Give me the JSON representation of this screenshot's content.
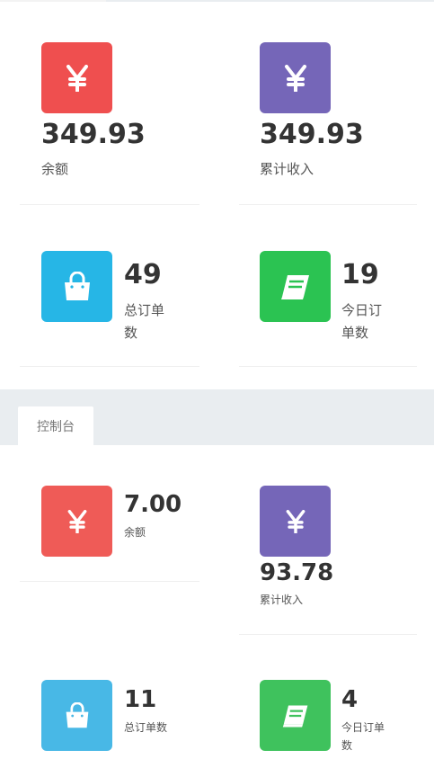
{
  "colors": {
    "red": "#ef4f4f",
    "purple": "#7566b8",
    "blue": "#26b6e6",
    "green": "#2bc352",
    "red_light": "#ef5b57",
    "blue_light": "#48b8e6",
    "green_light": "#3fc25d",
    "band": "#e9edf0"
  },
  "overview": {
    "balance": {
      "icon": "yen-icon",
      "value": "349.93",
      "label": "余额"
    },
    "total_income": {
      "icon": "yen-icon",
      "value": "349.93",
      "label": "累计收入"
    },
    "total_orders": {
      "icon": "shopping-bag-icon",
      "value": "49",
      "label_line1": "总订单",
      "label_line2": "数"
    },
    "today_orders": {
      "icon": "book-icon",
      "value": "19",
      "label_line1": "今日订",
      "label_line2": "单数"
    }
  },
  "console": {
    "tab_label": "控制台",
    "balance": {
      "icon": "yen-icon",
      "value": "7.00",
      "label": "余额"
    },
    "total_income": {
      "icon": "yen-icon",
      "value": "93.78",
      "label": "累计收入"
    },
    "total_orders": {
      "icon": "shopping-bag-icon",
      "value": "11",
      "label": "总订单数"
    },
    "today_orders": {
      "icon": "book-icon",
      "value": "4",
      "label_line1": "今日订单",
      "label_line2": "数"
    }
  }
}
